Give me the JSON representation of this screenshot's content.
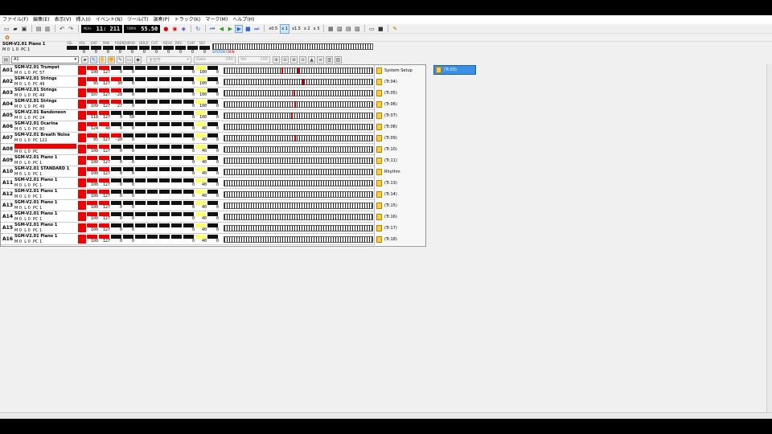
{
  "menu": [
    "ファイル(F)",
    "編集(E)",
    "表示(V)",
    "挿入(I)",
    "イベント(N)",
    "ツール(T)",
    "演奏(P)",
    "トラック(K)",
    "マーク(M)",
    "ヘルプ(H)"
  ],
  "transport": {
    "meas_label": "MEAS",
    "position": "11: 211",
    "tempo_label": "TEMPO",
    "tempo": "55.50"
  },
  "speeds": [
    "x0.5",
    "x 1",
    "x1.5",
    "x 2",
    "x 3"
  ],
  "current": {
    "title": "SGM-V2.01 Piano 1",
    "m_label": "M",
    "l_label": "L",
    "pc_label": "PC",
    "m": "0",
    "l": "0",
    "pc": "1",
    "vals": [
      "0",
      "0",
      "0",
      "0",
      "0",
      "0",
      "0",
      "0",
      "0",
      "0",
      "0"
    ],
    "ctrl_labels": [
      "VEL",
      "VOL",
      "EXP",
      "PAN",
      "P.BEND",
      "MOD",
      "HOLD",
      "CUT",
      "RESO",
      "REV",
      "CHO",
      "DLY"
    ],
    "sys_text": "SYSTEM",
    "sys_text2": "CMIN"
  },
  "ctrl": {
    "part": "A1",
    "scope": "全音符",
    "gate_label": "Gate",
    "gate": "240",
    "vel_label": "Vel",
    "vel": "100"
  },
  "tracks": [
    {
      "id": "A01",
      "name": "SGM-V2.01 Trumpet",
      "m": "0",
      "l": "0",
      "pc": "57",
      "vol": "100",
      "exp": "127",
      "pan": "0",
      "pb": "0",
      "rev": "0",
      "cho": "100",
      "dly": "0",
      "track": "System Setup"
    },
    {
      "id": "A02",
      "name": "SGM-V2.01 Strings",
      "m": "0",
      "l": "0",
      "pc": "49",
      "vol": "95",
      "exp": "127",
      "pan": "30",
      "pb": "0",
      "rev": "0",
      "cho": "100",
      "dly": "0",
      "track": "(Tr.04)"
    },
    {
      "id": "A03",
      "name": "SGM-V2.01 Strings",
      "m": "0",
      "l": "0",
      "pc": "49",
      "vol": "107",
      "exp": "127",
      "pan": "-28",
      "pb": "0",
      "rev": "0",
      "cho": "100",
      "dly": "0",
      "track": "(Tr.05)"
    },
    {
      "id": "A04",
      "name": "SGM-V2.01 Strings",
      "m": "0",
      "l": "0",
      "pc": "49",
      "vol": "109",
      "exp": "127",
      "pan": "27",
      "pb": "0",
      "rev": "0",
      "cho": "100",
      "dly": "0",
      "track": "(Tr.06)"
    },
    {
      "id": "A05",
      "name": "SGM-V2.01 Bandoneon",
      "m": "0",
      "l": "0",
      "pc": "24",
      "vol": "118",
      "exp": "127",
      "pan": "0",
      "pb": "50",
      "rev": "0",
      "cho": "100",
      "dly": "0",
      "track": "(Tr.07)"
    },
    {
      "id": "A06",
      "name": "SGM-V2.01 Ocarina",
      "m": "0",
      "l": "0",
      "pc": "80",
      "vol": "124",
      "exp": "40",
      "pan": "0",
      "pb": "0",
      "rev": "0",
      "cho": "40",
      "dly": "0",
      "track": "(Tr.08)"
    },
    {
      "id": "A07",
      "name": "SGM-V2.01 Breath Noise",
      "m": "0",
      "l": "0",
      "pc": "122",
      "vol": "95",
      "exp": "127",
      "pan": "-20",
      "pb": "0",
      "rev": "0",
      "cho": "40",
      "dly": "0",
      "track": "(Tr.09)"
    },
    {
      "id": "A08",
      "name": "",
      "m": "0",
      "l": "0",
      "pc": "",
      "vol": "100",
      "exp": "127",
      "pan": "0",
      "pb": "0",
      "rev": "0",
      "cho": "40",
      "dly": "0",
      "track": "(Tr.10)"
    },
    {
      "id": "A09",
      "name": "SGM-V2.01 Piano 1",
      "m": "0",
      "l": "0",
      "pc": "1",
      "vol": "100",
      "exp": "127",
      "pan": "0",
      "pb": "0",
      "rev": "0",
      "cho": "40",
      "dly": "0",
      "track": "(Tr.11)"
    },
    {
      "id": "A10",
      "name": "SGM-V2.01 STANDARD 1",
      "m": "0",
      "l": "0",
      "pc": "1",
      "vol": "100",
      "exp": "127",
      "pan": "0",
      "pb": "0",
      "rev": "0",
      "cho": "40",
      "dly": "0",
      "track": "Rhythm"
    },
    {
      "id": "A11",
      "name": "SGM-V2.01 Piano 1",
      "m": "0",
      "l": "0",
      "pc": "1",
      "vol": "100",
      "exp": "127",
      "pan": "0",
      "pb": "0",
      "rev": "0",
      "cho": "40",
      "dly": "0",
      "track": "(Tr.13)"
    },
    {
      "id": "A12",
      "name": "SGM-V2.01 Piano 1",
      "m": "0",
      "l": "0",
      "pc": "1",
      "vol": "100",
      "exp": "127",
      "pan": "0",
      "pb": "0",
      "rev": "0",
      "cho": "40",
      "dly": "0",
      "track": "(Tr.14)"
    },
    {
      "id": "A13",
      "name": "SGM-V2.01 Piano 1",
      "m": "0",
      "l": "0",
      "pc": "1",
      "vol": "100",
      "exp": "127",
      "pan": "0",
      "pb": "0",
      "rev": "0",
      "cho": "40",
      "dly": "0",
      "track": "(Tr.15)"
    },
    {
      "id": "A14",
      "name": "SGM-V2.01 Piano 1",
      "m": "0",
      "l": "0",
      "pc": "1",
      "vol": "100",
      "exp": "127",
      "pan": "0",
      "pb": "0",
      "rev": "0",
      "cho": "40",
      "dly": "0",
      "track": "(Tr.16)"
    },
    {
      "id": "A15",
      "name": "SGM-V2.01 Piano 1",
      "m": "0",
      "l": "0",
      "pc": "1",
      "vol": "100",
      "exp": "127",
      "pan": "0",
      "pb": "0",
      "rev": "0",
      "cho": "40",
      "dly": "0",
      "track": "(Tr.17)"
    },
    {
      "id": "A16",
      "name": "SGM-V2.01 Piano 1",
      "m": "0",
      "l": "0",
      "pc": "1",
      "vol": "100",
      "exp": "127",
      "pan": "0",
      "pb": "0",
      "rev": "0",
      "cho": "40",
      "dly": "0",
      "track": "(Tr.18)"
    }
  ],
  "selected_track": "(Tr.03)",
  "colors": {
    "accent": "#3a8fe8",
    "red": "#e00000",
    "lcd": "#000000"
  }
}
